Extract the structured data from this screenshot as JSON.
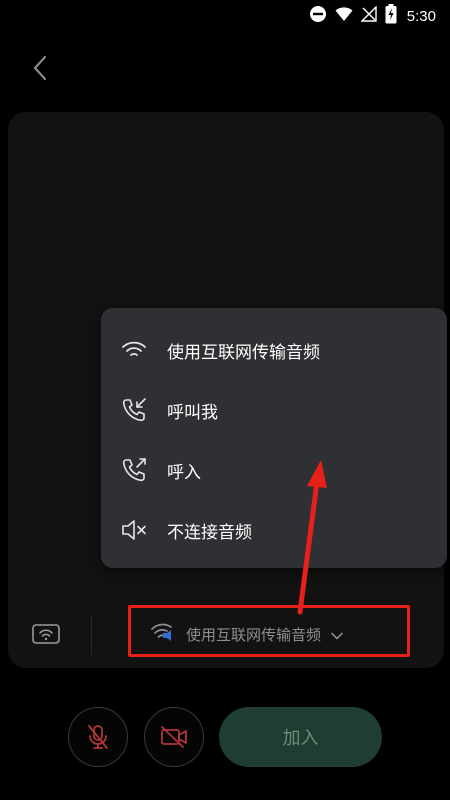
{
  "status_bar": {
    "time": "5:30"
  },
  "audio_menu": {
    "items": [
      {
        "label": "使用互联网传输音频",
        "icon": "wifi-icon"
      },
      {
        "label": "呼叫我",
        "icon": "phone-incoming-icon"
      },
      {
        "label": "呼入",
        "icon": "phone-outgoing-icon"
      },
      {
        "label": "不连接音频",
        "icon": "speaker-muted-icon"
      }
    ]
  },
  "audio_selector": {
    "label": "使用互联网传输音频",
    "icon": "internet-audio-icon"
  },
  "join_button": {
    "label": "加入"
  },
  "colors": {
    "background": "#000000",
    "menu_background": "#2e3033",
    "join_button": "#1f3d30",
    "mute_icon_red": "#b3333a",
    "highlight_red": "#e8201a"
  }
}
